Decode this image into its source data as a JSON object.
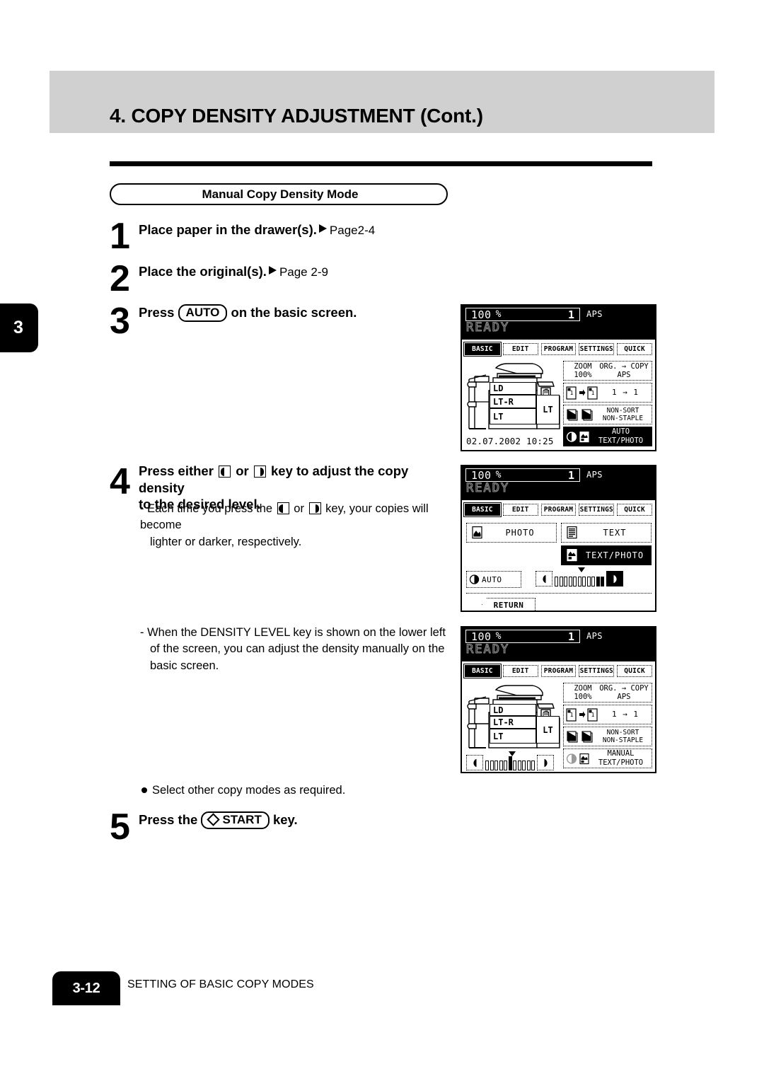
{
  "header": {
    "title": "4. COPY DENSITY ADJUSTMENT (Cont.)",
    "section_label": "Manual Copy Density Mode",
    "chapter_tab": "3"
  },
  "steps": [
    {
      "number": "1",
      "text_bold": "Place paper in the drawer(s).",
      "ref": "Page2-4"
    },
    {
      "number": "2",
      "text_bold": "Place the original(s).",
      "ref": "Page 2-9"
    },
    {
      "number": "3",
      "text_before": "Press",
      "keycap": "AUTO",
      "text_after": "on the basic screen."
    },
    {
      "number": "4",
      "line1_a": "Press either",
      "line1_b": "or",
      "line1_c": "key to adjust the copy density",
      "line2": "to the desired level.",
      "note1_a": "-  Each time you press the",
      "note1_b": "or",
      "note1_c": "key, your copies will become",
      "note2": "lighter or darker, respectively."
    },
    {
      "number": "5",
      "text_before": "Press the",
      "keycap": "START",
      "text_after": "key."
    }
  ],
  "notes": {
    "density_level_note": "-  When the DENSITY LEVEL key is shown on the lower left of the screen, you can adjust the density manually on the basic screen.",
    "density_level_note_lines": [
      "-  When the DENSITY LEVEL key is shown on the lower left",
      "of the screen, you can adjust the density manually on the",
      "basic screen."
    ],
    "select_other_modes": "Select other copy modes as required."
  },
  "lcd_common": {
    "ratio": "100",
    "percent": "%",
    "copy_count": "1",
    "paper_mode": "APS",
    "status": "READY",
    "tabs": [
      "BASIC",
      "EDIT",
      "PROGRAM",
      "SETTINGS",
      "QUICK"
    ],
    "active_tab": "BASIC"
  },
  "lcd_basic": {
    "datetime": "02.07.2002 10:25",
    "drawers": [
      "LD",
      "LT-R",
      "LT"
    ],
    "bypass_label": "LT",
    "zoom_label": "ZOOM",
    "zoom_value": "100%",
    "org_copy_label": "ORG. → COPY",
    "org_copy_value": "APS",
    "duplex_value": "1 → 1",
    "finisher_line1": "NON-SORT",
    "finisher_line2": "NON-STAPLE",
    "density_line1_auto": "AUTO",
    "density_line1_manual": "MANUAL",
    "density_line2": "TEXT/PHOTO"
  },
  "lcd_density": {
    "photo_label": "PHOTO",
    "text_label": "TEXT",
    "text_photo_label": "TEXT/PHOTO",
    "auto_label": "AUTO",
    "return_label": "RETURN",
    "slider_segments": 11,
    "slider_filled_index": 9,
    "slider_pointer_index": 5
  },
  "lcd_basic_manual": {
    "slider_segments": 11,
    "slider_pointer_index": 5
  },
  "footer": {
    "page_number": "3-12",
    "chapter_title": "SETTING OF BASIC COPY MODES"
  },
  "colors": {
    "header_band": "#d0d0d0",
    "ink": "#000000",
    "paper": "#ffffff"
  }
}
